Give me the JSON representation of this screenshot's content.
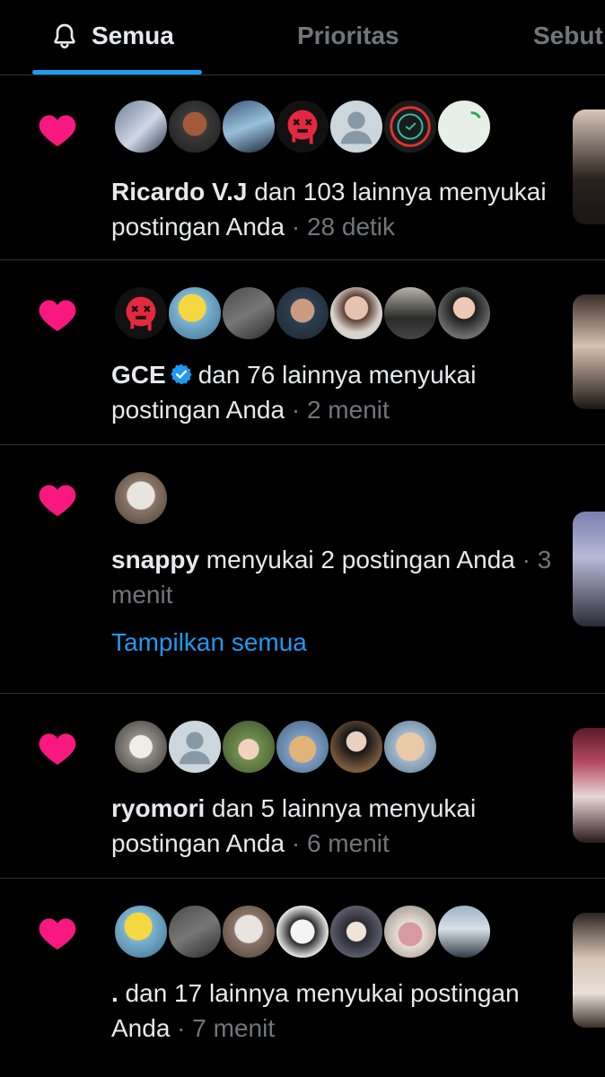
{
  "tabs": [
    {
      "label": "Semua",
      "active": true
    },
    {
      "label": "Prioritas",
      "active": false
    },
    {
      "label": "Sebut",
      "active": false
    }
  ],
  "colors": {
    "accent": "#1d9bf0",
    "heart": "#f91880",
    "muted": "#71767b",
    "divider": "#2f3336"
  },
  "notifications": [
    {
      "name": "Ricardo V.J",
      "verified": false,
      "message": " dan 103 lainnya menyukai postingan Anda",
      "time": "28 detik",
      "avatar_count": 7,
      "show_all": ""
    },
    {
      "name": "GCE",
      "verified": true,
      "message": "dan 76 lainnya menyukai postingan Anda",
      "time": "2 menit",
      "avatar_count": 7,
      "show_all": ""
    },
    {
      "name": "snappy",
      "verified": false,
      "message": " menyukai 2 postingan Anda",
      "time": "3 menit",
      "avatar_count": 1,
      "show_all": "Tampilkan semua"
    },
    {
      "name": "ryomori",
      "verified": false,
      "message": " dan 5 lainnya menyukai postingan Anda",
      "time": "6 menit",
      "avatar_count": 6,
      "show_all": ""
    },
    {
      "name": ".",
      "verified": false,
      "message": " dan 17 lainnya menyukai postingan Anda",
      "time": "7 menit",
      "avatar_count": 7,
      "show_all": ""
    }
  ]
}
